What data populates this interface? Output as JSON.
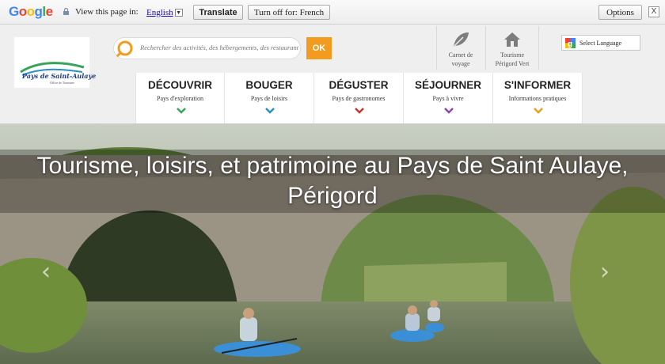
{
  "translate_bar": {
    "logo_letters": [
      "G",
      "o",
      "o",
      "g",
      "l",
      "e"
    ],
    "logo_colors": [
      "#4285f4",
      "#ea4335",
      "#fbbc05",
      "#4285f4",
      "#34a853",
      "#ea4335"
    ],
    "view_label": "View this page in:",
    "language": "English",
    "translate_button": "Translate",
    "turn_off_button": "Turn off for: French",
    "options_button": "Options",
    "close_glyph": "X"
  },
  "header": {
    "logo_text": "Pays de Saint-Aulaye",
    "logo_subtext": "Office de Tourisme",
    "search_placeholder": "Rechercher des activités, des hébergements, des restaurants",
    "search_button": "OK",
    "quick_links": [
      {
        "label_line1": "Carnet de",
        "label_line2": "voyage",
        "icon": "leaf-icon"
      },
      {
        "label_line1": "Tourisme",
        "label_line2": "Périgord Vert",
        "icon": "house-icon"
      }
    ],
    "language_select": "Select Language"
  },
  "nav": {
    "items": [
      {
        "title": "DÉCOUVRIR",
        "subtitle": "Pays d'exploration",
        "color": "#3aa35b"
      },
      {
        "title": "BOUGER",
        "subtitle": "Pays de loisirs",
        "color": "#2a8fc4"
      },
      {
        "title": "DÉGUSTER",
        "subtitle": "Pays de gastronomes",
        "color": "#c0392b"
      },
      {
        "title": "SÉJOURNER",
        "subtitle": "Pays à vivre",
        "color": "#8e44ad"
      },
      {
        "title": "S'INFORMER",
        "subtitle": "Informations pratiques",
        "color": "#e6a21a"
      }
    ]
  },
  "hero": {
    "title": "Tourisme, loisirs, et patrimoine au Pays de Saint Aulaye, Périgord",
    "prev_arrow": "‹",
    "next_arrow": "›"
  },
  "colors": {
    "accent_orange": "#f39b1e",
    "header_bg": "#efefef"
  }
}
